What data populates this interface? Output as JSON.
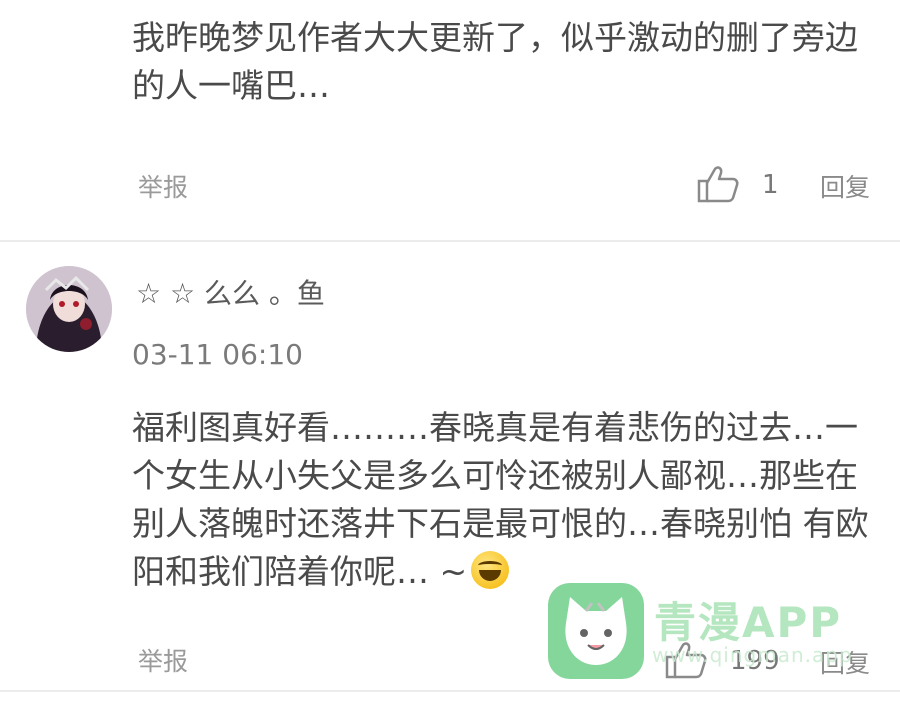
{
  "comments": [
    {
      "text": "我昨晚梦见作者大大更新了，似乎激动的删了旁边的人一嘴巴…",
      "report_label": "举报",
      "like_count": "1",
      "reply_label": "回复"
    },
    {
      "username": "☆ ☆ 么么 。鱼",
      "time": "03-11 06:10",
      "text": "福利图真好看………春晓真是有着悲伤的过去…一个女生从小失父是多么可怜还被别人鄙视…那些在别人落魄时还落井下石是最可恨的…春晓别怕 有欧阳和我们陪着你呢… ~",
      "emoji": "grinning-squinting-face",
      "report_label": "举报",
      "like_count": "199",
      "reply_label": "回复"
    }
  ],
  "watermark": {
    "title": "青漫APP",
    "url": "www.qingman.app"
  },
  "colors": {
    "text": "#4a4a4a",
    "secondary": "#9a9a9a",
    "divider": "#ececec",
    "watermark_green": "#6fd089"
  }
}
